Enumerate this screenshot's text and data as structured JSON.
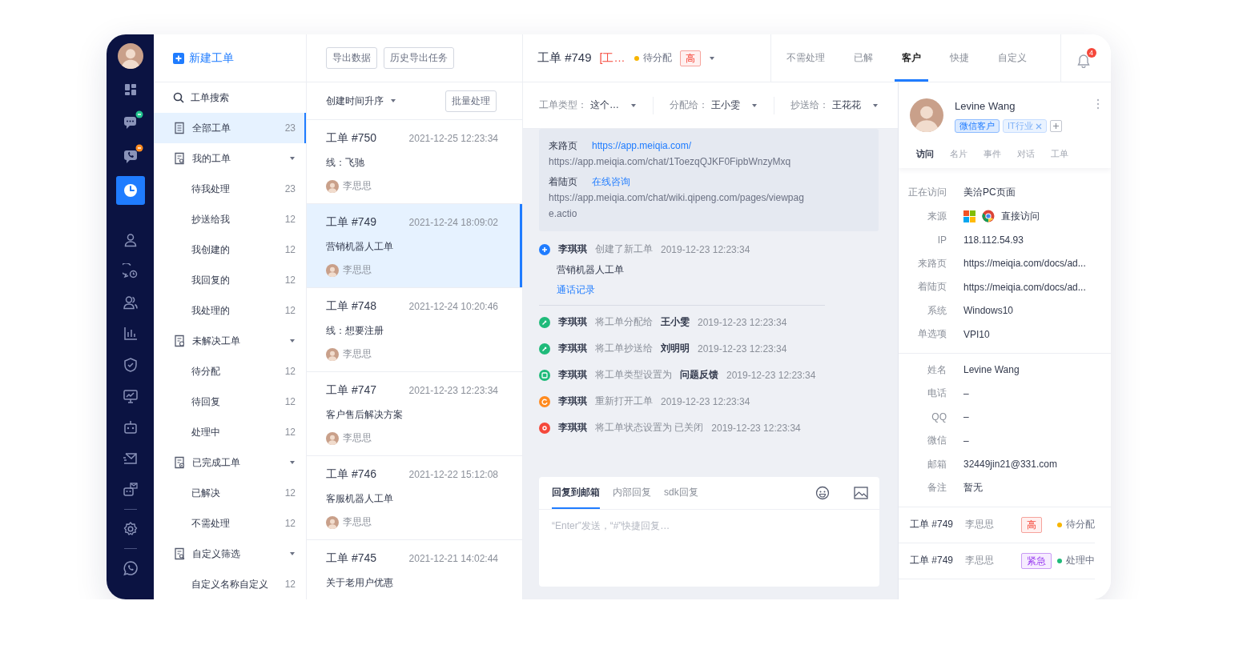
{
  "nav": {
    "items": [
      {
        "selected": false
      },
      {
        "selected": false,
        "color": "#22c38e"
      },
      {
        "selected": false,
        "color": "#ff8a1f"
      },
      {
        "selected": true
      },
      {
        "selected": false
      },
      {
        "selected": false
      },
      {
        "selected": false
      },
      {
        "selected": false
      },
      {
        "selected": false
      },
      {
        "selected": false
      },
      {
        "selected": false
      },
      {
        "selected": false
      },
      {
        "selected": false
      },
      {
        "selected": false
      },
      {
        "selected": false
      }
    ]
  },
  "sidebar": {
    "new_button": "新建工单",
    "items": [
      {
        "kind": "search",
        "label": "工单搜索",
        "selected": false
      },
      {
        "kind": "all",
        "label": "全部工单",
        "count": "23",
        "selected": true
      },
      {
        "kind": "group",
        "label": "我的工单",
        "expanded": true,
        "children": [
          {
            "label": "待我处理",
            "count": "23",
            "selected": false
          },
          {
            "label": "抄送给我",
            "count": "12",
            "selected": false
          },
          {
            "label": "我创建的",
            "count": "12",
            "selected": false
          },
          {
            "label": "我回复的",
            "count": "12",
            "selected": false
          },
          {
            "label": "我处理的",
            "count": "12",
            "selected": false
          }
        ]
      },
      {
        "kind": "group",
        "label": "未解决工单",
        "expanded": true,
        "children": [
          {
            "label": "待分配",
            "count": "12",
            "selected": false
          },
          {
            "label": "待回复",
            "count": "12",
            "selected": false
          },
          {
            "label": "处理中",
            "count": "12",
            "selected": false
          }
        ]
      },
      {
        "kind": "group",
        "label": "已完成工单",
        "expanded": true,
        "children": [
          {
            "label": "已解决",
            "count": "12",
            "selected": false
          },
          {
            "label": "不需处理",
            "count": "12",
            "selected": false
          }
        ]
      },
      {
        "kind": "group",
        "label": "自定义筛选",
        "expanded": true,
        "children": [
          {
            "label": "自定义名称自定义",
            "count": "12",
            "selected": false
          }
        ]
      }
    ]
  },
  "ticket_list": {
    "actions": [
      "导出数据",
      "历史导出任务"
    ],
    "sort": "创建时间升序",
    "batch_button": "批量处理",
    "tickets": [
      {
        "title": "工单 #750",
        "time": "2021-12-25 12:23:34",
        "subtitle": "线：飞驰",
        "assignee": "李思思",
        "selected": false
      },
      {
        "title": "工单 #749",
        "time": "2021-12-24 18:09:02",
        "subtitle": "营销机器人工单",
        "assignee": "李思思",
        "selected": true
      },
      {
        "title": "工单 #748",
        "time": "2021-12-24 10:20:46",
        "subtitle": "线：想要注册",
        "assignee": "李思思",
        "selected": false
      },
      {
        "title": "工单 #747",
        "time": "2021-12-23 12:23:34",
        "subtitle": "客户售后解决方案",
        "assignee": "李思思",
        "selected": false
      },
      {
        "title": "工单 #746",
        "time": "2021-12-22 15:12:08",
        "subtitle": "客服机器人工单",
        "assignee": "李思思",
        "selected": false
      },
      {
        "title": "工单 #745",
        "time": "2021-12-21 14:02:44",
        "subtitle": "关于老用户优惠",
        "selected": false
      }
    ]
  },
  "header": {
    "title": "工单 #749",
    "tag": "[工…",
    "status": {
      "label": "待分配",
      "color": "#f7b500"
    },
    "priority": {
      "label": "高",
      "kind": "high"
    }
  },
  "top_tabs": [
    {
      "label": "不需处理",
      "selected": false
    },
    {
      "label": "已解",
      "selected": false
    },
    {
      "label": "客户",
      "selected": true
    },
    {
      "label": "快捷",
      "selected": false
    },
    {
      "label": "自定义",
      "selected": false
    }
  ],
  "notifications": {
    "count": "4"
  },
  "detail": {
    "filters": [
      {
        "label": "工单类型：",
        "value": "这个…"
      },
      {
        "label": "分配给：",
        "value": "王小雯"
      },
      {
        "label": "抄送给：",
        "value": "王花花"
      }
    ],
    "source": [
      {
        "label": "来路页",
        "link": "https://app.meiqia.com/",
        "url": "https://app.meiqia.com/chat/1ToezqQJKF0FipbWnzyMxq"
      },
      {
        "label": "着陆页",
        "link": "在线咨询",
        "url": "https://app.meiqia.com/chat/wiki.qipeng.com/pages/viewpage.actio"
      }
    ],
    "activity": [
      {
        "kind": "create",
        "color": "#1f7cff",
        "actor": "李琪琪",
        "action": "创建了新工单",
        "time": "2019-12-23 12:23:34",
        "note": "营销机器人工单",
        "link": "通话记录"
      },
      {
        "kind": "assign",
        "color": "#1fba7a",
        "actor": "李琪琪",
        "action": "将工单分配给",
        "target": "王小雯",
        "time": "2019-12-23 12:23:34"
      },
      {
        "kind": "assign",
        "color": "#1fba7a",
        "actor": "李琪琪",
        "action": "将工单抄送给",
        "target": "刘明明",
        "time": "2019-12-23 12:23:34"
      },
      {
        "kind": "type",
        "color": "#1fba7a",
        "actor": "李琪琪",
        "action": "将工单类型设置为",
        "target": "问题反馈",
        "time": "2019-12-23 12:23:34"
      },
      {
        "kind": "reopen",
        "color": "#ff8a1f",
        "actor": "李琪琪",
        "action": "重新打开工单",
        "time": "2019-12-23 12:23:34"
      },
      {
        "kind": "close",
        "color": "#f5483b",
        "actor": "李琪琪",
        "action": "将工单状态设置为 已关闭",
        "time": "2019-12-23 12:23:34"
      }
    ],
    "reply": {
      "tabs": [
        {
          "label": "回复到邮箱",
          "selected": true
        },
        {
          "label": "内部回复",
          "selected": false
        },
        {
          "label": "sdk回复",
          "selected": false
        }
      ],
      "placeholder": "“Enter”发送，“#”快捷回复…"
    }
  },
  "customer": {
    "name": "Levine Wang",
    "tags": [
      {
        "label": "微信客户",
        "kind": "primary",
        "removable": false
      },
      {
        "label": "IT行业",
        "kind": "light",
        "removable": true
      }
    ],
    "tabs": [
      {
        "label": "访问",
        "selected": true
      },
      {
        "label": "名片",
        "selected": false
      },
      {
        "label": "事件",
        "selected": false
      },
      {
        "label": "对话",
        "selected": false
      },
      {
        "label": "工单",
        "selected": false
      }
    ],
    "visit": [
      {
        "label": "正在访问",
        "value": "美洽PC页面"
      },
      {
        "label": "来源",
        "value": "直接访问",
        "kind": "source"
      },
      {
        "label": "IP",
        "value": "118.112.54.93"
      },
      {
        "label": "来路页",
        "value": "https://meiqia.com/docs/ad..."
      },
      {
        "label": "着陆页",
        "value": "https://meiqia.com/docs/ad..."
      },
      {
        "label": "系统",
        "value": "Windows10"
      },
      {
        "label": "单选项",
        "value": "VPI10"
      }
    ],
    "contact": [
      {
        "label": "姓名",
        "value": "Levine Wang"
      },
      {
        "label": "电话",
        "value": "–"
      },
      {
        "label": "QQ",
        "value": "–"
      },
      {
        "label": "微信",
        "value": "–"
      },
      {
        "label": "邮箱",
        "value": "32449jin21@331.com"
      },
      {
        "label": "备注",
        "value": "暂无"
      }
    ],
    "tickets": [
      {
        "title": "工单 #749",
        "assignee": "李思思",
        "priority": {
          "label": "高",
          "kind": "high"
        },
        "status": {
          "label": "待分配",
          "color": "#f7b500"
        }
      },
      {
        "title": "工单 #749",
        "assignee": "李思思",
        "priority": {
          "label": "紧急",
          "kind": "urgent"
        },
        "status": {
          "label": "处理中",
          "color": "#1fba7a"
        }
      }
    ]
  }
}
